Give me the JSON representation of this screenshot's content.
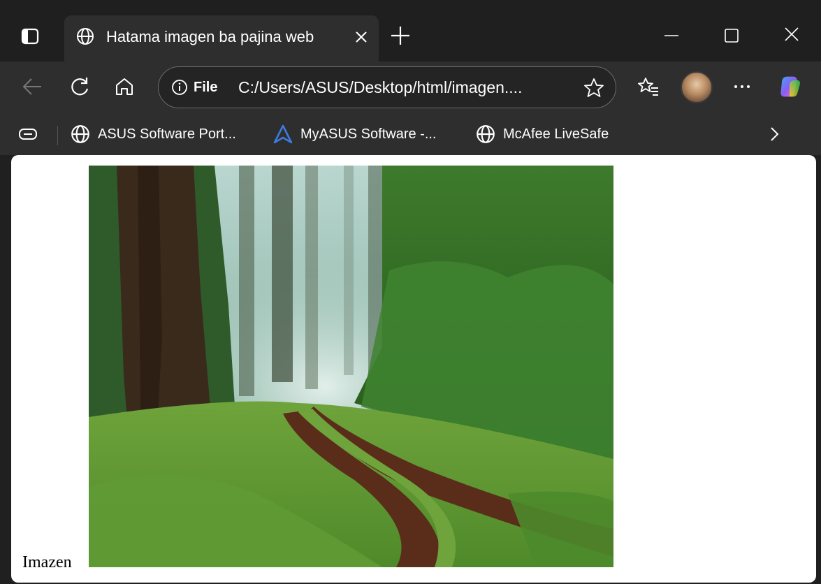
{
  "browser": {
    "tab": {
      "title": "Hatama imagen ba pajina web"
    },
    "address_bar": {
      "site_info_label": "File",
      "url": "C:/Users/ASUS/Desktop/html/imagen...."
    },
    "favorites": [
      {
        "label": "ASUS Software Port...",
        "icon": "globe-icon"
      },
      {
        "label": "MyASUS Software -...",
        "icon": "myasus-icon"
      },
      {
        "label": "McAfee LiveSafe",
        "icon": "globe-icon"
      }
    ]
  },
  "page": {
    "image_alt_text": "Imazen",
    "image_subject": "forest-dirt-road"
  },
  "colors": {
    "titlebar": "#1f1f1f",
    "toolbar": "#2e2e2e",
    "page_bg": "#ffffff",
    "accent_blue": "#3d7be0"
  }
}
